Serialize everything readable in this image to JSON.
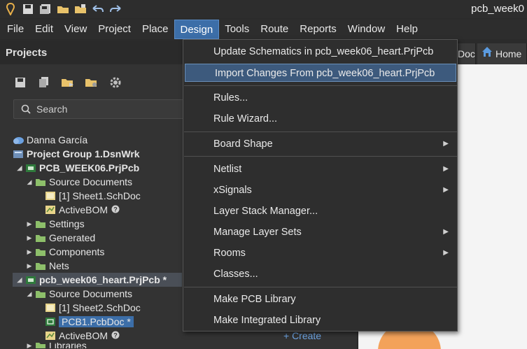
{
  "window": {
    "title": "pcb_week0"
  },
  "menubar": {
    "items": [
      {
        "label": "File"
      },
      {
        "label": "Edit"
      },
      {
        "label": "View"
      },
      {
        "label": "Project"
      },
      {
        "label": "Place"
      },
      {
        "label": "Design"
      },
      {
        "label": "Tools"
      },
      {
        "label": "Route"
      },
      {
        "label": "Reports"
      },
      {
        "label": "Window"
      },
      {
        "label": "Help"
      }
    ]
  },
  "projects_panel": {
    "title": "Projects",
    "search_placeholder": "Search",
    "tree": [
      {
        "label": "Danna García"
      },
      {
        "label": "Project Group 1.DsnWrk"
      },
      {
        "label": "PCB_WEEK06.PrjPcb"
      },
      {
        "label": "Source Documents"
      },
      {
        "label": "[1] Sheet1.SchDoc"
      },
      {
        "label": "ActiveBOM"
      },
      {
        "label": "Settings"
      },
      {
        "label": "Generated"
      },
      {
        "label": "Components"
      },
      {
        "label": "Nets"
      },
      {
        "label": "pcb_week06_heart.PrjPcb *"
      },
      {
        "label": "Source Documents"
      },
      {
        "label": "[1] Sheet2.SchDoc"
      },
      {
        "label": "PCB1.PcbDoc *"
      },
      {
        "label": "ActiveBOM"
      },
      {
        "label": "Libraries"
      }
    ],
    "create_link": "+ Create"
  },
  "doc_tabs": [
    {
      "label": "Doc"
    },
    {
      "label": "Home"
    }
  ],
  "design_menu": {
    "items": [
      {
        "label": "Update Schematics in pcb_week06_heart.PrjPcb",
        "submenu": false
      },
      {
        "label": "Import Changes From pcb_week06_heart.PrjPcb",
        "submenu": false
      },
      {
        "label": "Rules...",
        "submenu": false
      },
      {
        "label": "Rule Wizard...",
        "submenu": false
      },
      {
        "label": "Board Shape",
        "submenu": true
      },
      {
        "label": "Netlist",
        "submenu": true
      },
      {
        "label": "xSignals",
        "submenu": true
      },
      {
        "label": "Layer Stack Manager...",
        "submenu": false
      },
      {
        "label": "Manage Layer Sets",
        "submenu": true
      },
      {
        "label": "Rooms",
        "submenu": true
      },
      {
        "label": "Classes...",
        "submenu": false
      },
      {
        "label": "Make PCB Library",
        "submenu": false
      },
      {
        "label": "Make Integrated Library",
        "submenu": false
      }
    ],
    "submenu_glyph": "▶"
  },
  "colors": {
    "accent": "#3c6ea8",
    "highlight": "#3d5a7d",
    "background": "#2b2b2b",
    "link": "#6ea6e6"
  }
}
